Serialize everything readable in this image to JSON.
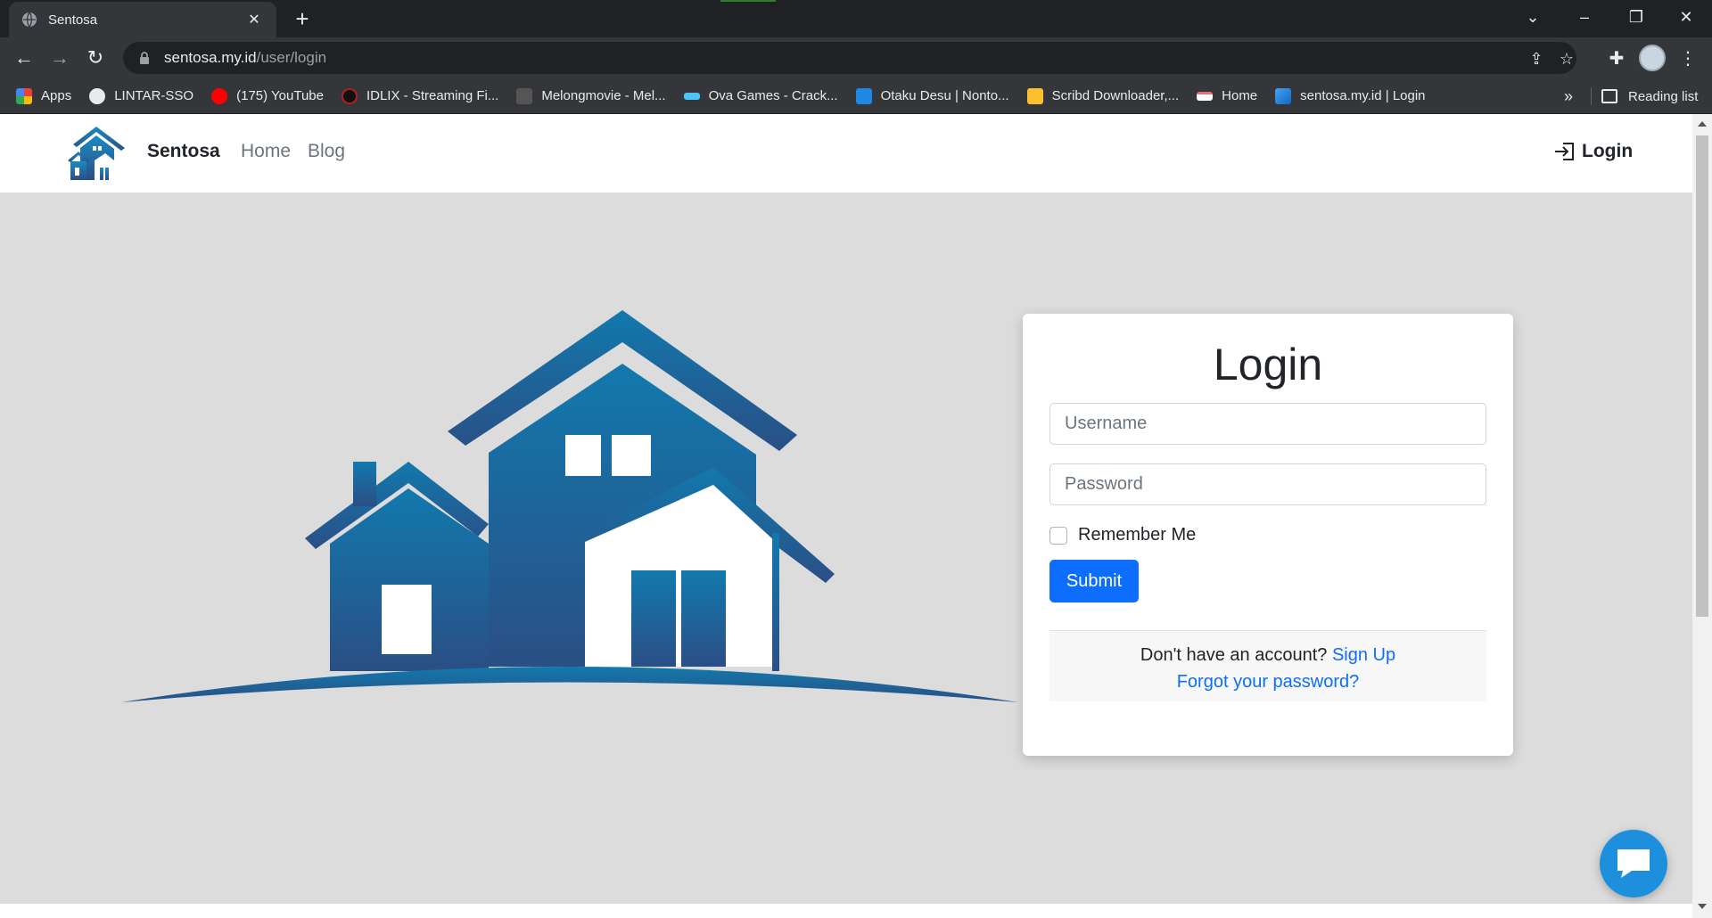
{
  "browser": {
    "tab_title": "Sentosa",
    "url_domain": "sentosa.my.id",
    "url_path": "/user/login",
    "bookmarks": [
      {
        "label": "Apps",
        "icon": "apps-grid-icon",
        "color": "#ea4335"
      },
      {
        "label": "LINTAR-SSO",
        "icon": "globe-icon",
        "color": "#e8eaed"
      },
      {
        "label": "(175) YouTube",
        "icon": "youtube-icon",
        "color": "#ff0000"
      },
      {
        "label": "IDLIX - Streaming Fi...",
        "icon": "idlix-icon",
        "color": "#b71c1c"
      },
      {
        "label": "Melongmovie - Mel...",
        "icon": "melongmovie-icon",
        "color": "#9e9e9e"
      },
      {
        "label": "Ova Games - Crack...",
        "icon": "ovagames-icon",
        "color": "#4fc3f7"
      },
      {
        "label": "Otaku Desu | Nonto...",
        "icon": "otakudesu-icon",
        "color": "#1e88e5"
      },
      {
        "label": "Scribd Downloader,...",
        "icon": "scribd-icon",
        "color": "#fbc02d"
      },
      {
        "label": "Home",
        "icon": "home-site-icon",
        "color": "#e57373"
      },
      {
        "label": "sentosa.my.id | Login",
        "icon": "sentosa-icon",
        "color": "#42a5f5"
      }
    ],
    "more_label": "»",
    "reading_list_label": "Reading list"
  },
  "navbar": {
    "brand": "Sentosa",
    "links": [
      "Home",
      "Blog"
    ],
    "login_label": "Login"
  },
  "login_card": {
    "title": "Login",
    "username_placeholder": "Username",
    "password_placeholder": "Password",
    "remember_label": "Remember Me",
    "submit_label": "Submit",
    "no_account_text": "Don't have an account?",
    "signup_label": "Sign Up",
    "forgot_label": "Forgot your password?"
  },
  "colors": {
    "primary": "#0d6efd",
    "house_top": "#1279ad",
    "house_bottom": "#2a4f85",
    "chat": "#1e8fdc"
  }
}
